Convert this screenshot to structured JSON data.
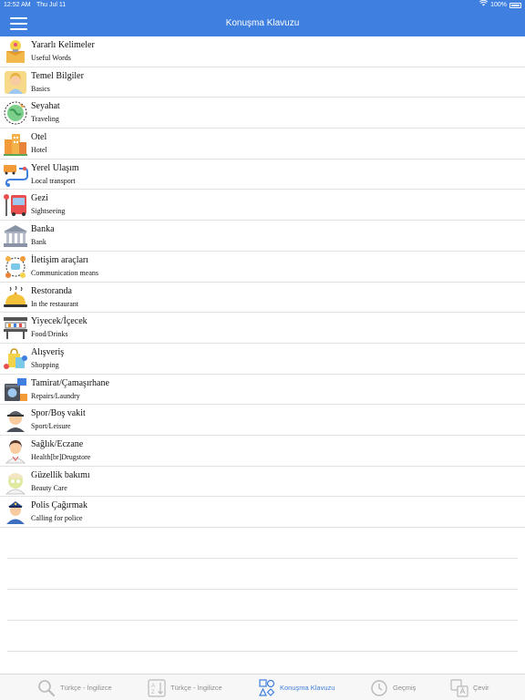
{
  "status": {
    "time": "12:52 AM",
    "date": "Thu Jul 11",
    "battery": "100%"
  },
  "navbar": {
    "title": "Konuşma Klavuzu"
  },
  "categories": [
    {
      "title": "Yararlı Kelimeler",
      "subtitle": "Useful Words",
      "icon": "lightbulb-box-icon"
    },
    {
      "title": "Temel Bilgiler",
      "subtitle": "Basics",
      "icon": "woman-icon"
    },
    {
      "title": "Seyahat",
      "subtitle": "Traveling",
      "icon": "globe-plane-icon"
    },
    {
      "title": "Otel",
      "subtitle": "Hotel",
      "icon": "hotel-buildings-icon"
    },
    {
      "title": "Yerel Ulaşım",
      "subtitle": "Local transport",
      "icon": "bus-route-icon"
    },
    {
      "title": "Gezi",
      "subtitle": "Sightseeing",
      "icon": "bus-stop-icon"
    },
    {
      "title": "Banka",
      "subtitle": "Bank",
      "icon": "bank-building-icon"
    },
    {
      "title": "İletişim araçları",
      "subtitle": "Communication means",
      "icon": "people-network-icon"
    },
    {
      "title": "Restoranda",
      "subtitle": "In the restaurant",
      "icon": "food-cloche-icon"
    },
    {
      "title": "Yiyecek/İçecek",
      "subtitle": "Food/Drinks",
      "icon": "cafe-table-icon"
    },
    {
      "title": "Alışveriş",
      "subtitle": "Shopping",
      "icon": "shopping-bags-icon"
    },
    {
      "title": "Tamirat/Çamaşırhane",
      "subtitle": "Repairs/Laundry",
      "icon": "washing-machine-icon"
    },
    {
      "title": "Spor/Boş vakit",
      "subtitle": "Sport/Leisure",
      "icon": "sport-person-icon"
    },
    {
      "title": "Sağlık/Eczane",
      "subtitle": "Health[br]Drugstore",
      "icon": "doctor-icon"
    },
    {
      "title": "Güzellik bakımı",
      "subtitle": "Beauty Care",
      "icon": "beauty-mask-icon"
    },
    {
      "title": "Polis Çağırmak",
      "subtitle": "Calling for police",
      "icon": "police-officer-icon"
    }
  ],
  "tabs": [
    {
      "label": "Türkçe - İngilizce",
      "icon": "search-icon",
      "active": false
    },
    {
      "label": "Türkçe - İngilizce",
      "icon": "sort-az-icon",
      "active": false
    },
    {
      "label": "Konuşma Klavuzu",
      "icon": "shapes-icon",
      "active": true
    },
    {
      "label": "Geçmiş",
      "icon": "history-clock-icon",
      "active": false
    },
    {
      "label": "Çevir",
      "icon": "translate-icon",
      "active": false
    }
  ],
  "colors": {
    "accent": "#3e7fe0",
    "divider": "#e2e2e2",
    "tab_inactive": "#8e8e8e"
  }
}
